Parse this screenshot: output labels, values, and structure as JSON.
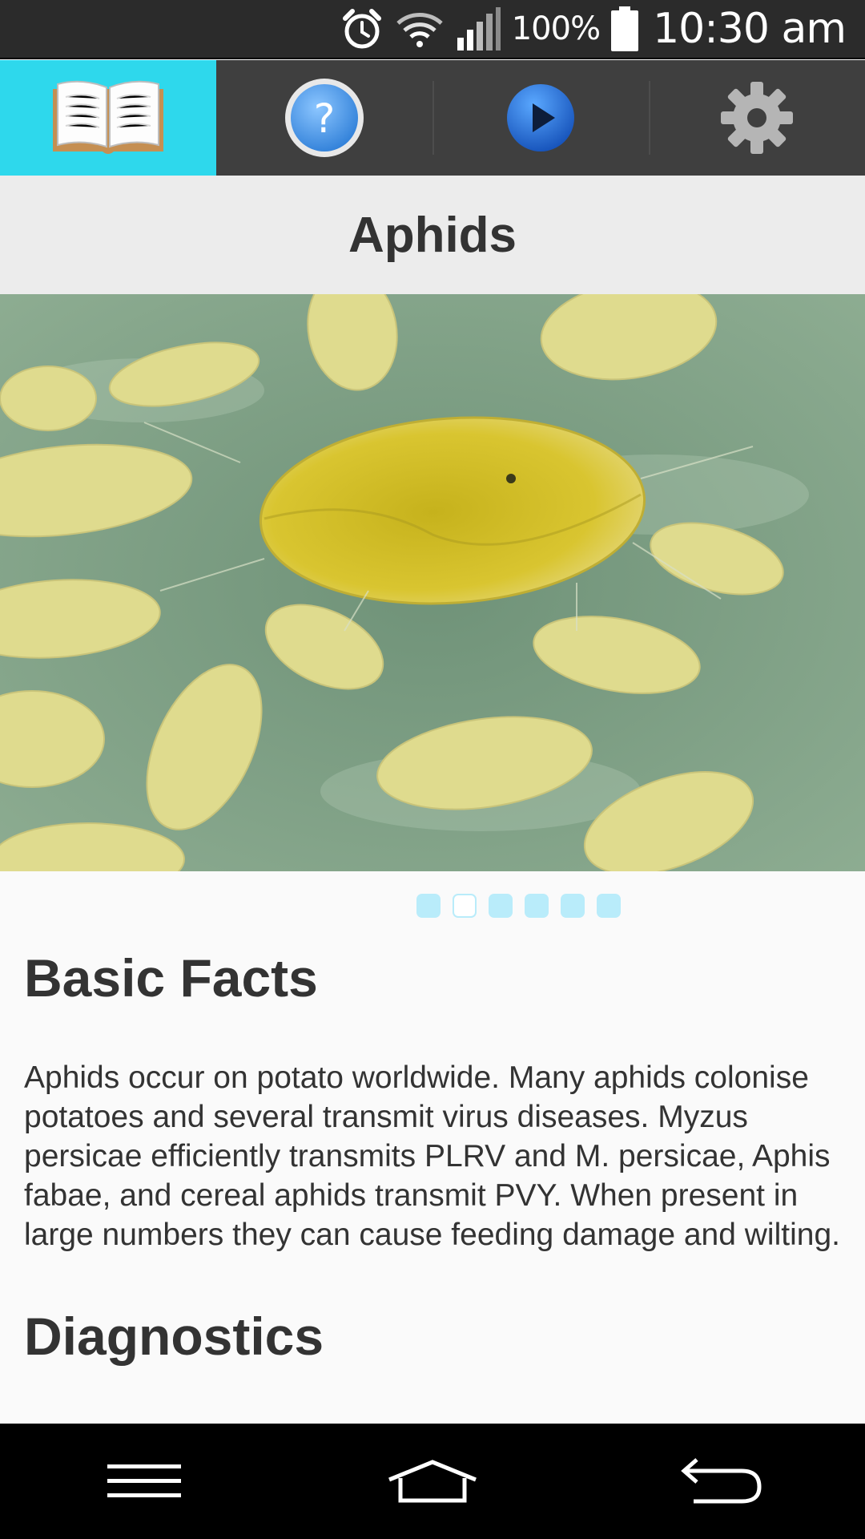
{
  "status_bar": {
    "battery_percent": "100%",
    "time": "10:30 am",
    "icons": [
      "alarm-icon",
      "wifi-icon",
      "signal-icon",
      "battery-icon"
    ]
  },
  "tabs": [
    {
      "name": "book-icon",
      "active": true
    },
    {
      "name": "help-icon",
      "active": false
    },
    {
      "name": "play-icon",
      "active": false
    },
    {
      "name": "settings-gear-icon",
      "active": false
    }
  ],
  "page": {
    "title": "Aphids"
  },
  "gallery": {
    "image_subject": "aphids-on-leaf",
    "dot_count": 6,
    "active_index": 1
  },
  "content": {
    "section1_heading": "Basic Facts",
    "section1_body": "Aphids occur on potato worldwide.  Many aphids colonise potatoes and several transmit virus diseases.  Myzus persicae efficiently transmits PLRV and M. persicae, Aphis fabae, and cereal aphids transmit PVY.  When present in large numbers they can cause feeding damage and wilting.",
    "section2_heading": "Diagnostics"
  },
  "nav_bar": {
    "icons": [
      "menu-icon",
      "home-icon",
      "back-icon"
    ]
  },
  "colors": {
    "accent": "#2ed8ec",
    "tab_bar": "#3f3f3f",
    "status_bar": "#2b2b2b",
    "pager_dot": "#b9ecfa"
  }
}
